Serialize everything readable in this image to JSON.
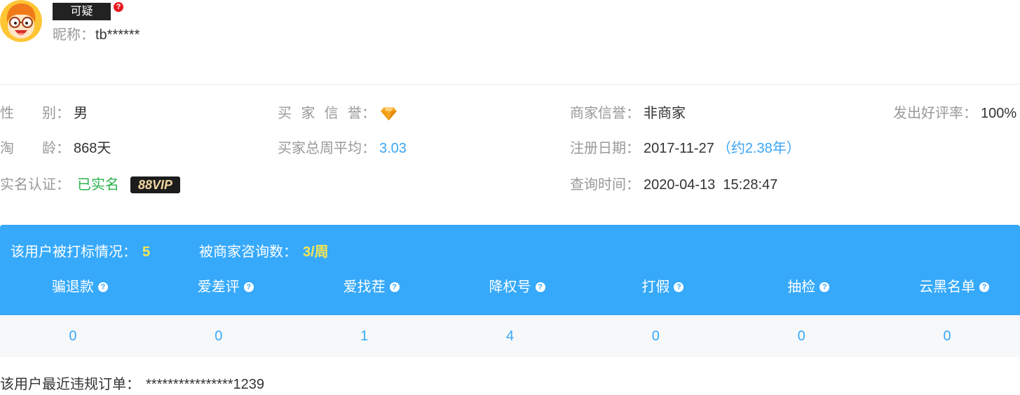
{
  "user": {
    "avatar": "cartoon-avatar-icon",
    "tag": "可疑",
    "nickname_label": "昵称",
    "nickname": "tb******"
  },
  "label_suffix": "：",
  "icons": {
    "tag_help": "question-circle-icon",
    "column_help": "question-circle-icon",
    "help_glyph": "?",
    "buyer_credit": "diamond-icon"
  },
  "info": {
    "gender": {
      "label": "性别",
      "value": "男"
    },
    "buyer_credit": {
      "label": "买家信誉",
      "level_icon": "diamond-icon"
    },
    "seller_credit": {
      "label": "商家信誉",
      "value": "非商家"
    },
    "positive_rate": {
      "label": "发出好评率",
      "value": "100%"
    },
    "account_age": {
      "label": "淘龄",
      "value": "868天"
    },
    "buyer_weekly_avg": {
      "label": "买家总周平均",
      "value": "3.03"
    },
    "register_date": {
      "label": "注册日期",
      "value": "2017-11-27",
      "note": "（约2.38年）"
    },
    "real_name": {
      "label": "实名认证",
      "value": "已实名",
      "badge": "88VIP"
    },
    "query_time": {
      "label": "查询时间",
      "value": "2020-04-13  15:28:47"
    }
  },
  "flags": {
    "marked_label": "该用户被打标情况",
    "marked_count": "5",
    "consult_label": "被商家咨询数",
    "consult_value": "3/周",
    "columns": [
      {
        "label": "骗退款",
        "value": "0"
      },
      {
        "label": "爱差评",
        "value": "0"
      },
      {
        "label": "爱找茬",
        "value": "1"
      },
      {
        "label": "降权号",
        "value": "4"
      },
      {
        "label": "打假",
        "value": "0"
      },
      {
        "label": "抽检",
        "value": "0"
      },
      {
        "label": "云黑名单",
        "value": "0"
      }
    ]
  },
  "violation": {
    "label": "该用户最近违规订单",
    "value": "****************1239"
  },
  "colors": {
    "accent_blue": "#36a9fb",
    "link_blue": "#3aa5f5",
    "highlight_yellow": "#f9e64f",
    "verified_green": "#28b34b",
    "label_gray": "#999999",
    "text_dark": "#333333",
    "vip_gold": "#f2d6a0",
    "tag_bg": "#222222",
    "alert_red": "#e8191e"
  }
}
